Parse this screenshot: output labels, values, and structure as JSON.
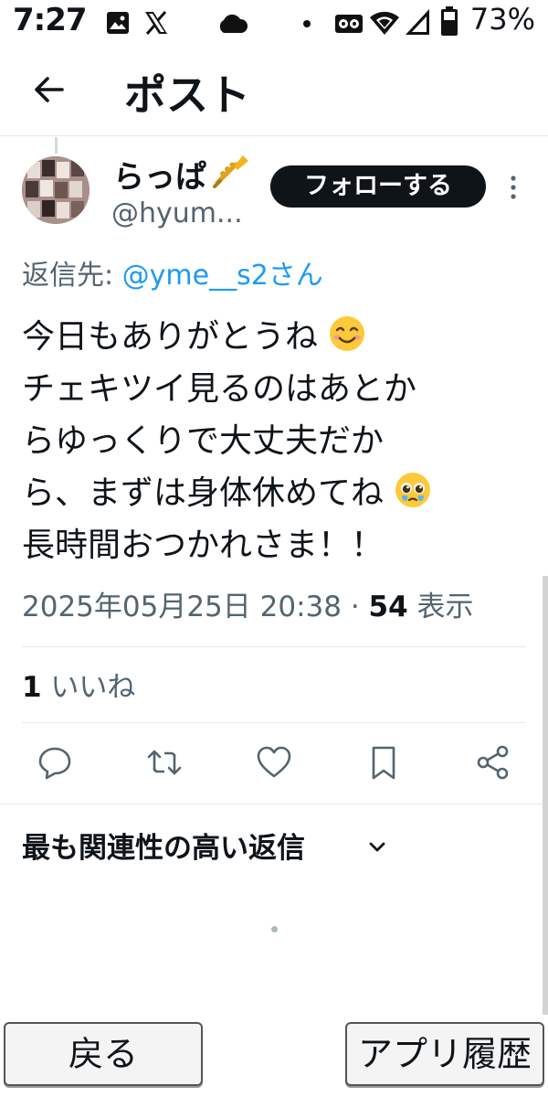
{
  "status_bar": {
    "time": "7:27",
    "battery": "73%",
    "icons": [
      "image-icon",
      "x-icon",
      "cloud-icon",
      "dot-icon",
      "voicemail-icon",
      "wifi-icon",
      "signal-icon",
      "battery-icon"
    ]
  },
  "header": {
    "title": "ポスト"
  },
  "post": {
    "display_name": "らっぱ",
    "handle": "@hyum...",
    "follow_label": "フォローする",
    "reply_to_label": "返信先:",
    "reply_to_mention": "@yme__s2さん",
    "text_lines": [
      "今日もありがとうね",
      "チェキツイ見るのはあとか",
      "らゆっくりで大丈夫だか",
      "ら、まずは身体休めてね",
      "長時間おつかれさま！！"
    ],
    "timestamp": "2025年05月25日 20:38 · ",
    "views_count": "54",
    "views_label": " 表示",
    "likes_count": "1",
    "likes_label": " いいね"
  },
  "replies": {
    "sort_label": "最も関連性の高い返信"
  },
  "bottom_nav": {
    "back_label": "戻る",
    "history_label": "アプリ履歴"
  },
  "colors": {
    "accent": "#1d9bf0",
    "text": "#0f1419",
    "secondary": "#536471",
    "follow_bg": "#0f1419"
  }
}
